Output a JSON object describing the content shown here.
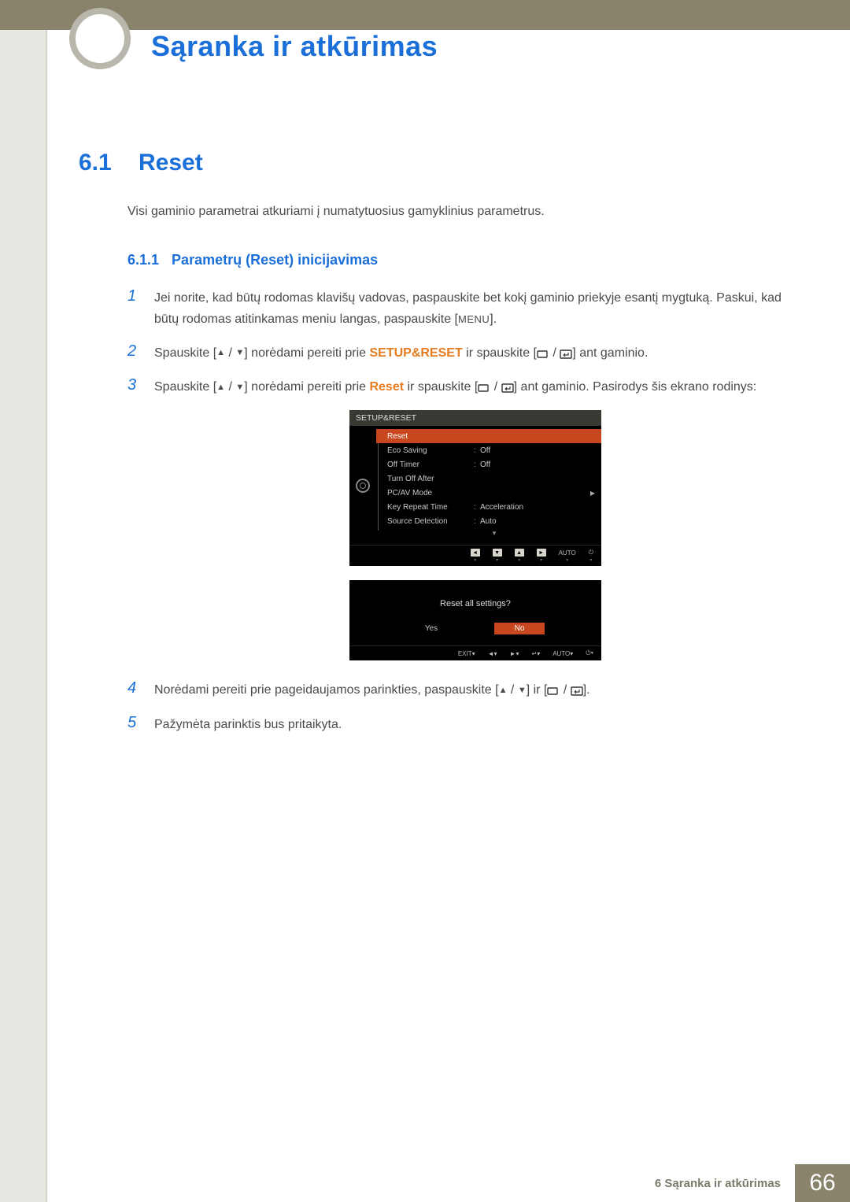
{
  "chapter_title": "Sąranka ir atkūrimas",
  "section": {
    "num": "6.1",
    "title": "Reset"
  },
  "intro": "Visi gaminio parametrai atkuriami į numatytuosius gamyklinius parametrus.",
  "subsection": {
    "num": "6.1.1",
    "title": "Parametrų (Reset) inicijavimas"
  },
  "steps": {
    "s1": {
      "num": "1",
      "a": "Jei norite, kad būtų rodomas klavišų vadovas, paspauskite bet kokį gaminio priekyje esantį mygtuką. Paskui, kad būtų rodomas atitinkamas meniu langas, paspauskite [",
      "menu": "MENU",
      "b": "]."
    },
    "s2": {
      "num": "2",
      "a": "Spauskite [",
      "b": "] norėdami pereiti prie ",
      "hl": "SETUP&RESET",
      "c": " ir spauskite [",
      "d": "] ant gaminio."
    },
    "s3": {
      "num": "3",
      "a": "Spauskite [",
      "b": "] norėdami pereiti prie ",
      "hl": "Reset",
      "c": " ir spauskite [",
      "d": "] ant gaminio. Pasirodys šis ekrano rodinys:"
    },
    "s4": {
      "num": "4",
      "a": "Norėdami pereiti prie pageidaujamos parinkties, paspauskite [",
      "b": "] ir [",
      "c": "]."
    },
    "s5": {
      "num": "5",
      "a": "Pažymėta parinktis bus pritaikyta."
    }
  },
  "osd1": {
    "header": "SETUP&RESET",
    "items": [
      {
        "label": "Reset",
        "value": "",
        "selected": true
      },
      {
        "label": "Eco Saving",
        "value": "Off"
      },
      {
        "label": "Off Timer",
        "value": "Off"
      },
      {
        "label": "Turn Off After",
        "value": ""
      },
      {
        "label": "PC/AV Mode",
        "value": "",
        "chevron": true
      },
      {
        "label": "Key Repeat Time",
        "value": "Acceleration"
      },
      {
        "label": "Source Detection",
        "value": "Auto"
      }
    ],
    "footer_auto": "AUTO"
  },
  "osd2": {
    "question": "Reset all settings?",
    "yes": "Yes",
    "no": "No",
    "exit": "EXIT",
    "auto": "AUTO"
  },
  "footer": {
    "chapter_label": "6 Sąranka ir atkūrimas",
    "page": "66"
  }
}
